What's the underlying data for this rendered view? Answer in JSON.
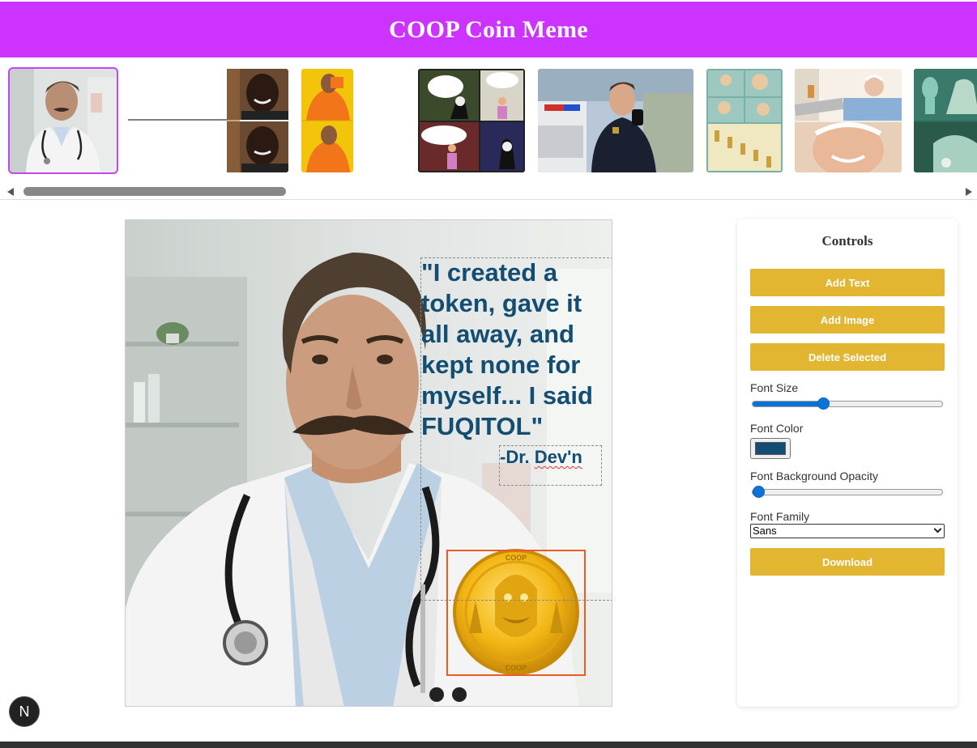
{
  "header": {
    "title": "COOP Coin Meme"
  },
  "gallery": {
    "items": [
      {
        "icon": "doctor-thumbnail"
      },
      {
        "icon": "reaction-meme-thumbnail"
      },
      {
        "icon": "drake-meme-thumbnail"
      },
      {
        "icon": "grim-reaper-comic-thumbnail"
      },
      {
        "icon": "police-officer-thumbnail"
      },
      {
        "icon": "brain-comic-thumbnail"
      },
      {
        "icon": "hide-the-pain-thumbnail"
      },
      {
        "icon": "squidward-thumbnail"
      }
    ]
  },
  "canvas": {
    "quote": "\"I created a token, gave it all away, and kept none for myself... I said FUQITOL\"",
    "author_prefix": "-Dr. ",
    "author_name": "Dev'n",
    "coin": {
      "top_text": "COOP",
      "bottom_text": "COOP"
    }
  },
  "controls": {
    "title": "Controls",
    "add_text": "Add Text",
    "add_image": "Add Image",
    "delete_selected": "Delete Selected",
    "font_size_label": "Font Size",
    "font_size_value": 0.36,
    "font_color_label": "Font Color",
    "font_color": "#134d72",
    "bg_opacity_label": "Font Background Opacity",
    "bg_opacity_value": 0,
    "font_family_label": "Font Family",
    "font_family_value": "Sans",
    "download": "Download"
  },
  "colors": {
    "header": "#cc33ff",
    "button": "#e2b631",
    "accent": "#0b74d6"
  },
  "badge": {
    "letter": "N"
  }
}
